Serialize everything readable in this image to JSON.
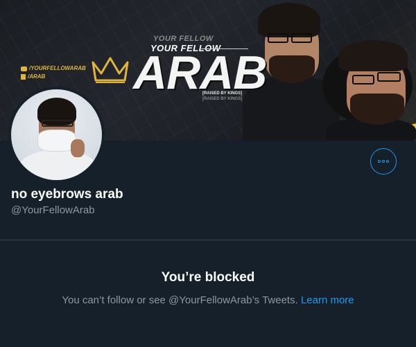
{
  "banner": {
    "small_line_1": "YOUR FELLOW",
    "small_line_2": "YOUR FELLOW",
    "title": "ARAB",
    "sub_line_1": "[RAISED BY KINGS]",
    "sub_line_2": "[RAISED BY KINGS]",
    "social_youtube": "/YOURFELLOWARAB",
    "social_twitch": "/ARAB",
    "accent_color": "#f0c419"
  },
  "profile": {
    "display_name": "no eyebrows arab",
    "handle": "@YourFellowArab",
    "more_icon": "more-horizontal-icon"
  },
  "blocked": {
    "title": "You’re blocked",
    "message_prefix": "You can’t follow or see @YourFellowArab’s Tweets. ",
    "learn_more_label": "Learn more"
  },
  "colors": {
    "background": "#15202b",
    "secondary_text": "#8b98a5",
    "link": "#1d9bf0",
    "divider": "#38444d"
  }
}
